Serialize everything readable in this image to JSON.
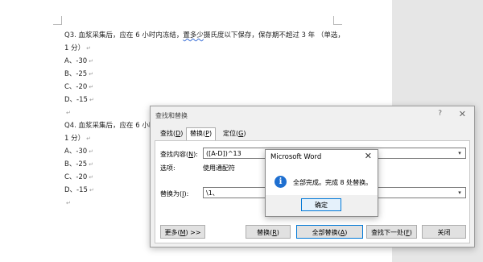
{
  "document": {
    "lines": [
      {
        "pre": "Q3. 血浆采集后，应在 6 小时内冻结，",
        "sq": "置多少",
        "post": "摄氏度以下保存，保存期不超过 3 年 （单选，",
        "pm": ""
      },
      {
        "pre": "1 分）",
        "sq": "",
        "post": "",
        "pm": "↵"
      },
      {
        "pre": "A、-30",
        "sq": "",
        "post": "",
        "pm": "↵"
      },
      {
        "pre": "B、-25",
        "sq": "",
        "post": "",
        "pm": "↵"
      },
      {
        "pre": "C、-20",
        "sq": "",
        "post": "",
        "pm": "↵"
      },
      {
        "pre": "D、-15",
        "sq": "",
        "post": "",
        "pm": "↵"
      },
      {
        "pre": "",
        "sq": "",
        "post": "",
        "pm": "↵"
      },
      {
        "pre": "Q4. 血浆采集后，应在 6 小时",
        "sq": "",
        "post": "",
        "pm": ""
      },
      {
        "pre": "1 分）",
        "sq": "",
        "post": "",
        "pm": "↵"
      },
      {
        "pre": "A、-30",
        "sq": "",
        "post": "",
        "pm": "↵"
      },
      {
        "pre": "B、-25",
        "sq": "",
        "post": "",
        "pm": "↵"
      },
      {
        "pre": "C、-20",
        "sq": "",
        "post": "",
        "pm": "↵"
      },
      {
        "pre": "D、-15",
        "sq": "",
        "post": "",
        "pm": "↵"
      },
      {
        "pre": "",
        "sq": "",
        "post": "",
        "pm": "↵"
      }
    ]
  },
  "find_replace": {
    "title": "查找和替换",
    "help": "?",
    "close": "✕",
    "tabs": {
      "find": {
        "text": "查找",
        "key": "D"
      },
      "replace": {
        "text": "替换",
        "key": "P"
      },
      "goto": {
        "text": "定位",
        "key": "G"
      }
    },
    "find_label": {
      "text": "查找内容",
      "key": "N",
      "suffix": ":"
    },
    "find_value": "([A-D])^13",
    "options_label": "选项:",
    "options_value": "使用通配符",
    "replace_label": {
      "text": "替换为",
      "key": "I",
      "suffix": ":"
    },
    "replace_value": "\\1、",
    "buttons": {
      "more": {
        "text": "更多",
        "key": "M",
        "suffix": " >>"
      },
      "replace": {
        "text": "替换",
        "key": "R"
      },
      "replace_all": {
        "text": "全部替换",
        "key": "A"
      },
      "find_next": {
        "text": "查找下一处",
        "key": "F"
      },
      "cancel": "关闭"
    }
  },
  "message_box": {
    "title": "Microsoft Word",
    "close": "✕",
    "icon": "info-icon",
    "text": "全部完成。完成 8 处替换。",
    "ok": "确定"
  },
  "colors": {
    "accent": "#0078d7",
    "info": "#1e6fd0"
  }
}
